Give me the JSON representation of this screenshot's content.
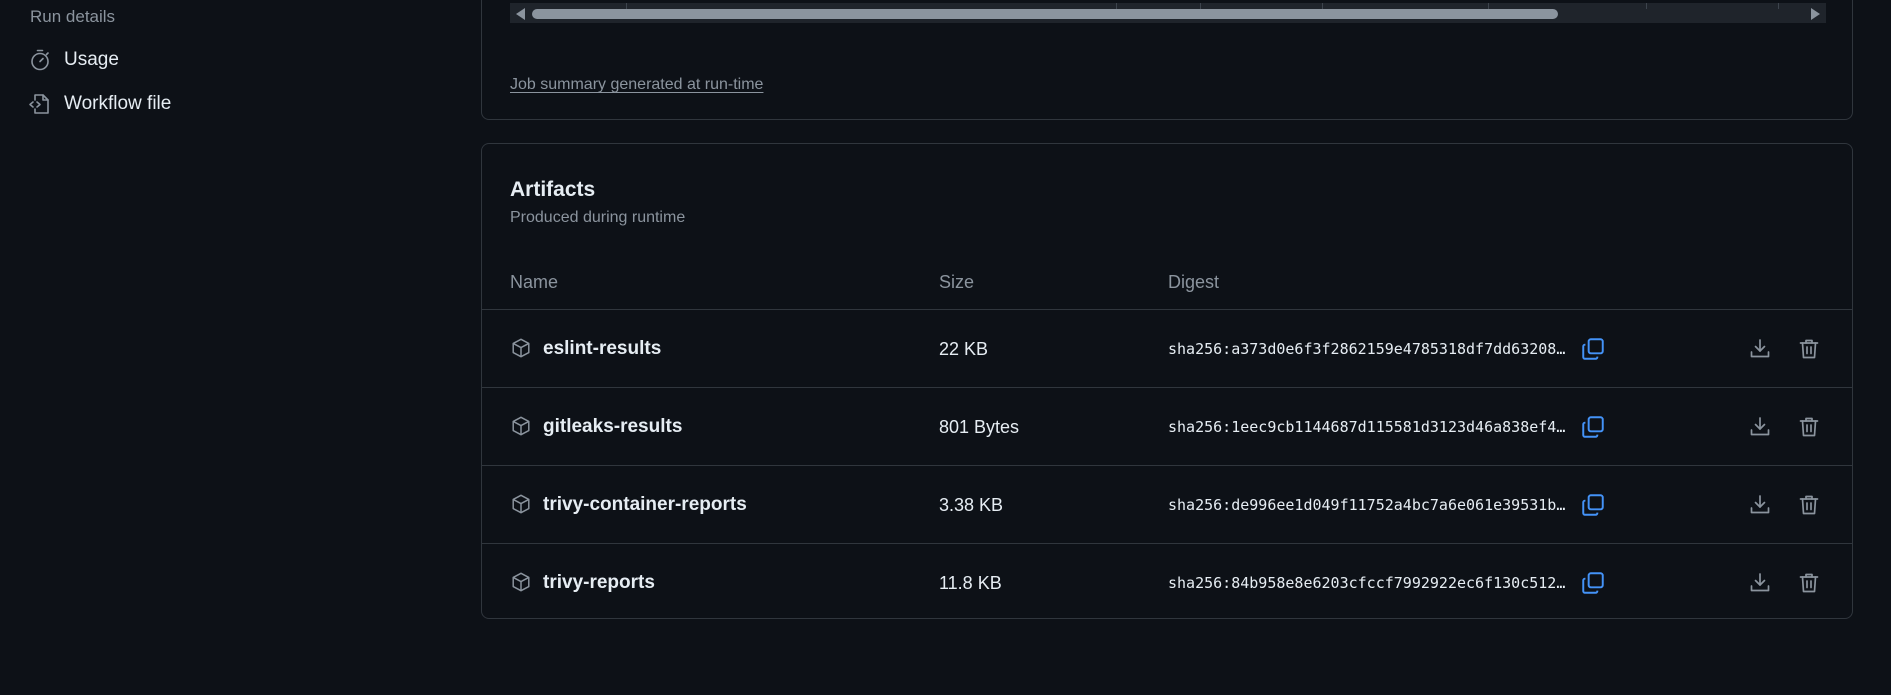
{
  "sidebar": {
    "heading": "Run details",
    "items": [
      {
        "label": "Usage",
        "icon": "stopwatch-icon"
      },
      {
        "label": "Workflow file",
        "icon": "file-code-icon"
      }
    ]
  },
  "summary": {
    "link_text": "Job summary generated at run-time"
  },
  "artifacts": {
    "title": "Artifacts",
    "subtitle": "Produced during runtime",
    "columns": {
      "name": "Name",
      "size": "Size",
      "digest": "Digest"
    },
    "rows": [
      {
        "name": "eslint-results",
        "size": "22 KB",
        "digest": "sha256:a373d0e6f3f2862159e4785318df7dd63208…"
      },
      {
        "name": "gitleaks-results",
        "size": "801 Bytes",
        "digest": "sha256:1eec9cb1144687d115581d3123d46a838ef4…"
      },
      {
        "name": "trivy-container-reports",
        "size": "3.38 KB",
        "digest": "sha256:de996ee1d049f11752a4bc7a6e061e39531b…"
      },
      {
        "name": "trivy-reports",
        "size": "11.8 KB",
        "digest": "sha256:84b958e8e6203cfccf7992922ec6f130c512…"
      }
    ]
  },
  "colors": {
    "background": "#0d1117",
    "border": "#30363d",
    "muted_text": "#8b949e",
    "accent_blue": "#4493f8"
  }
}
